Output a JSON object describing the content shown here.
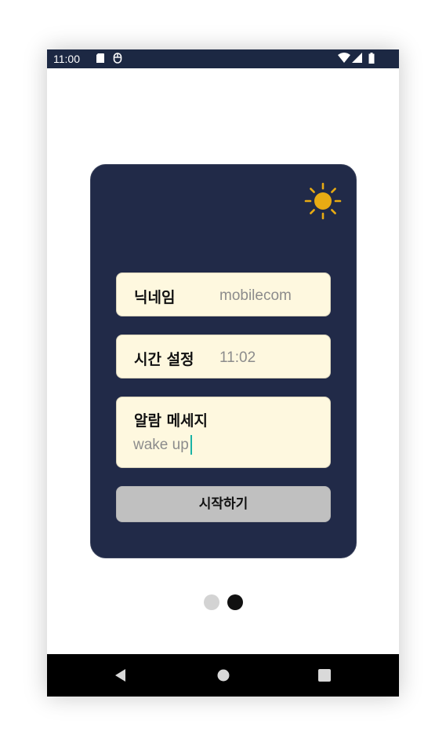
{
  "status_bar": {
    "time": "11:00",
    "icons": [
      "sd-card-icon",
      "mouse-icon",
      "wifi-icon",
      "signal-icon",
      "battery-icon"
    ]
  },
  "card": {
    "theme_icon": "sun-icon",
    "nickname": {
      "label": "닉네임",
      "value": "mobilecom"
    },
    "time_setting": {
      "label": "시간 설정",
      "value": "11:02"
    },
    "alarm_message": {
      "label": "알람 메세지",
      "value": "wake up"
    },
    "start_button": "시작하기"
  },
  "pager": {
    "count": 2,
    "active_index": 1
  },
  "nav_bar": {
    "icons": [
      "back-icon",
      "home-icon",
      "recents-icon"
    ]
  },
  "colors": {
    "status_bar": "#1c2843",
    "card": "#212a48",
    "field": "#fef8df",
    "sun": "#e8ab13",
    "button": "#c0c0c0",
    "dot_inactive": "#d3d3d3",
    "dot_active": "#111111",
    "caret": "#1ab3a6"
  }
}
